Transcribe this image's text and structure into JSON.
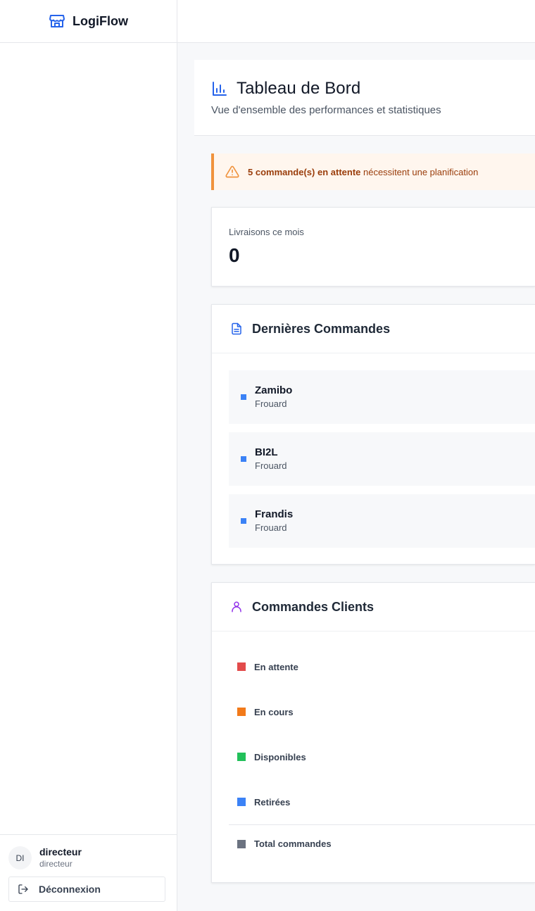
{
  "app": {
    "name": "LogiFlow"
  },
  "user": {
    "initials": "DI",
    "name": "directeur",
    "role": "directeur",
    "logout_label": "Déconnexion"
  },
  "header": {
    "title": "Tableau de Bord",
    "subtitle": "Vue d'ensemble des performances et statistiques"
  },
  "alert": {
    "count_text": "5 commande(s) en attente",
    "rest_text": " nécessitent une planification"
  },
  "stats": {
    "deliveries_label": "Livraisons ce mois",
    "deliveries_value": "0"
  },
  "recent_orders": {
    "title": "Dernières Commandes",
    "items": [
      {
        "name": "Zamibo",
        "city": "Frouard"
      },
      {
        "name": "BI2L",
        "city": "Frouard"
      },
      {
        "name": "Frandis",
        "city": "Frouard"
      }
    ]
  },
  "client_orders": {
    "title": "Commandes Clients",
    "statuses": [
      {
        "label": "En attente",
        "color": "#e24b4b"
      },
      {
        "label": "En cours",
        "color": "#f27a1a"
      },
      {
        "label": "Disponibles",
        "color": "#22c05a"
      },
      {
        "label": "Retirées",
        "color": "#3b82f6"
      }
    ],
    "total_label": "Total commandes",
    "total_color": "#6b7280"
  },
  "colors": {
    "accent": "#2563eb",
    "warning": "#f0923c",
    "purple": "#9333ea"
  }
}
